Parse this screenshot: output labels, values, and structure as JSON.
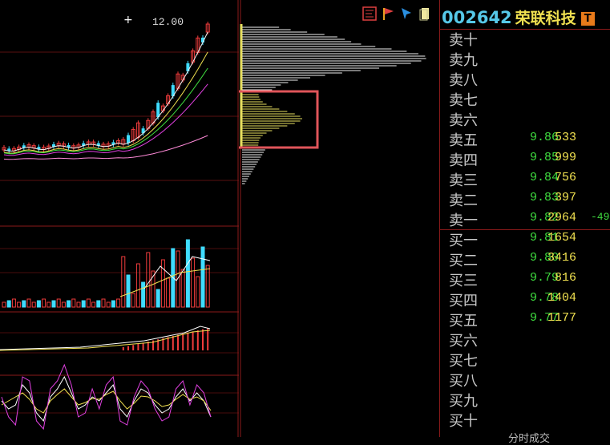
{
  "chart": {
    "peak_label": "12.00",
    "crosshair": "+"
  },
  "toolbar": {
    "icons": [
      "bar-chart-icon",
      "flag-icon",
      "pointer-icon",
      "note-icon"
    ]
  },
  "header": {
    "code": "002642",
    "name": "荣联科技",
    "badge": "T"
  },
  "colors": {
    "up": "#f03c3c",
    "down": "#3fdcff",
    "grid": "#8b1a1a",
    "chip_yellow": "#e8e060",
    "highlight_box": "#e0555a"
  },
  "order_book": {
    "asks": [
      {
        "label": "卖十",
        "price": "",
        "volume": ""
      },
      {
        "label": "卖九",
        "price": "",
        "volume": ""
      },
      {
        "label": "卖八",
        "price": "",
        "volume": ""
      },
      {
        "label": "卖七",
        "price": "",
        "volume": ""
      },
      {
        "label": "卖六",
        "price": "",
        "volume": ""
      },
      {
        "label": "卖五",
        "price": "9.86",
        "volume": "533"
      },
      {
        "label": "卖四",
        "price": "9.85",
        "volume": "999"
      },
      {
        "label": "卖三",
        "price": "9.84",
        "volume": "756"
      },
      {
        "label": "卖二",
        "price": "9.83",
        "volume": "397"
      },
      {
        "label": "卖一",
        "price": "9.82",
        "volume": "2964",
        "extra": "-49"
      }
    ],
    "bids": [
      {
        "label": "买一",
        "price": "9.81",
        "volume": "1654"
      },
      {
        "label": "买二",
        "price": "9.80",
        "volume": "3416"
      },
      {
        "label": "买三",
        "price": "9.79",
        "volume": "816"
      },
      {
        "label": "买四",
        "price": "9.78",
        "volume": "1404"
      },
      {
        "label": "买五",
        "price": "9.77",
        "volume": "1177"
      },
      {
        "label": "买六",
        "price": "",
        "volume": ""
      },
      {
        "label": "买七",
        "price": "",
        "volume": ""
      },
      {
        "label": "买八",
        "price": "",
        "volume": ""
      },
      {
        "label": "买九",
        "price": "",
        "volume": ""
      },
      {
        "label": "买十",
        "price": "",
        "volume": ""
      }
    ]
  },
  "footer": {
    "text": "分时成交"
  }
}
